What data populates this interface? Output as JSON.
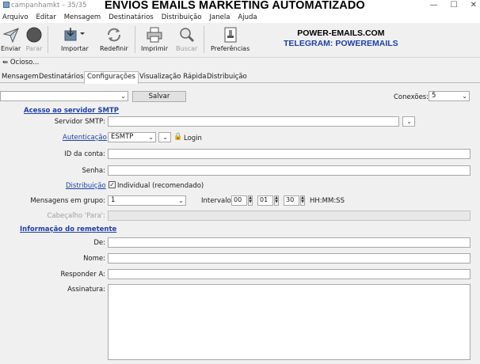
{
  "window": {
    "title": "campanhamkt – 35/35",
    "banner": "ENVIOS EMAILS MARKETING AUTOMATIZADO",
    "controls": [
      "—",
      "☐",
      "✕"
    ]
  },
  "menu": [
    "Arquivo",
    "Editar",
    "Mensagem",
    "Destinatários",
    "Distribuição",
    "Janela",
    "Ajuda"
  ],
  "toolbar": {
    "send": "Enviar",
    "stop": "Parar",
    "import": "Importar",
    "reset": "Redefinir",
    "print": "Imprimir",
    "search": "Buscar",
    "preferences": "Preferências"
  },
  "promo": {
    "line1": "POWER-EMAILS.COM",
    "line2": "TELEGRAM: POWEREMAILS"
  },
  "status": "Ocioso...",
  "tabs": [
    "Mensagem",
    "Destinatários",
    "Configurações",
    "Visualização Rápida",
    "Distribuição"
  ],
  "config": {
    "profile_value": "",
    "save_label": "Salvar",
    "connections_label": "Conexões:",
    "connections_value": "5",
    "smtp_access_heading": "Acesso ao servidor SMTP",
    "smtp_server_label": "Servidor SMTP:",
    "smtp_server_value": "",
    "auth_link": "Autenticação",
    "auth_value": "ESMTP",
    "login_label": "Login",
    "account_id_label": "ID da conta:",
    "password_label": "Senha:",
    "distribution_link": "Distribuição",
    "individual_label": "Individual (recomendado)",
    "group_messages_label": "Mensagens em grupo:",
    "group_messages_value": "1",
    "interval_label": "Intervalo:",
    "interval_h": "00",
    "interval_m": "01",
    "interval_s": "30",
    "interval_format": "HH:MM:SS",
    "to_header_label": "Cabeçalho 'Para':",
    "sender_heading": "Informação do remetente",
    "from_label": "De:",
    "name_label": "Nome:",
    "reply_to_label": "Responder A:",
    "signature_label": "Assinatura:"
  }
}
